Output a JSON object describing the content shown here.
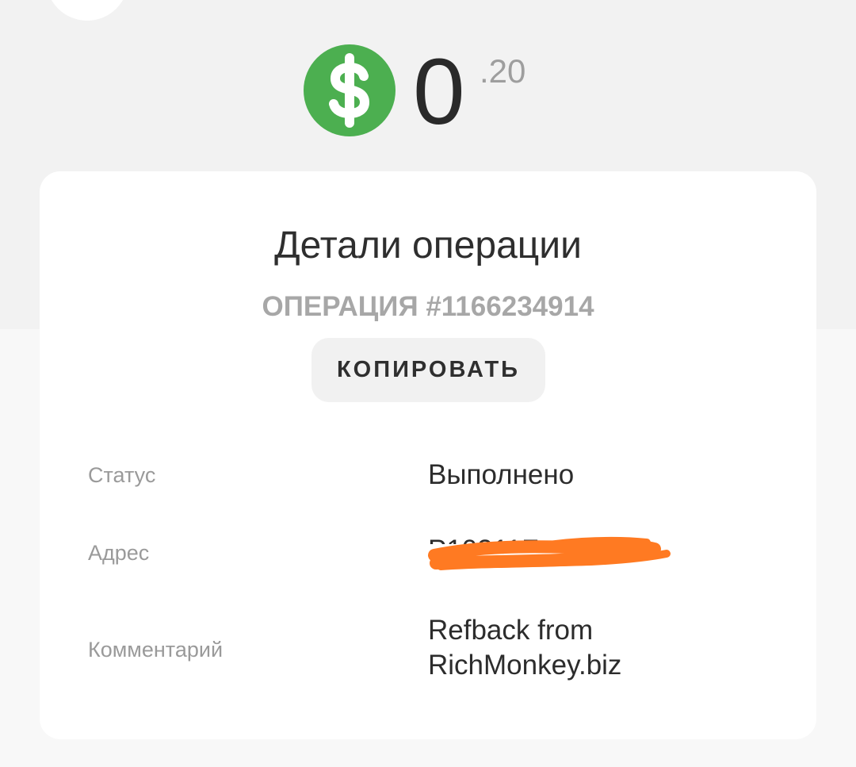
{
  "balance": {
    "integer": "0",
    "fraction": ".20",
    "currency_icon": "dollar-sign-icon",
    "currency_color": "#4caf50"
  },
  "details": {
    "title": "Детали операции",
    "operation_id": "ОПЕРАЦИЯ #1166234914",
    "copy_label": "КОПИРОВАТЬ",
    "rows": [
      {
        "label": "Статус",
        "value": "Выполнено"
      },
      {
        "label": "Адрес",
        "value": "P10311F"
      },
      {
        "label": "Комментарий",
        "value": "Refback from RichMonkey.biz"
      }
    ]
  },
  "colors": {
    "redaction": "#ff7a22"
  }
}
